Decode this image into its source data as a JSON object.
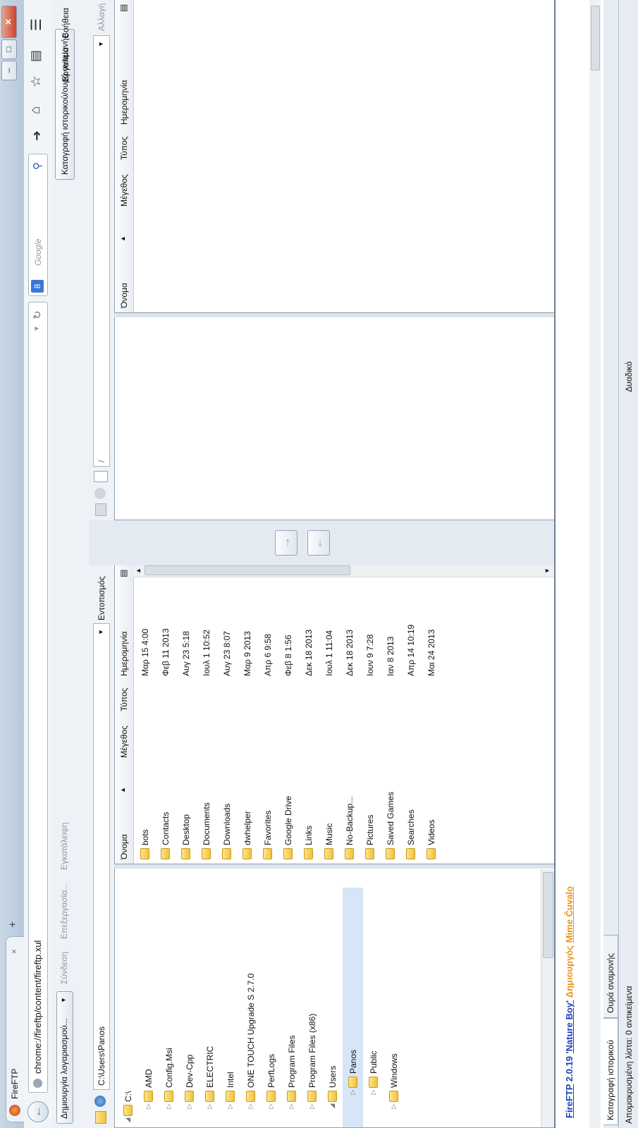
{
  "window": {
    "tab_title": "FireFTP",
    "tab_close": "×",
    "new_tab": "+",
    "caption": {
      "minimize": "–",
      "restore": "□",
      "close": "✕"
    }
  },
  "navbar": {
    "url": "chrome://fireftp/content/fireftp.xul",
    "search_placeholder": "Google",
    "search_engine_letter": "8"
  },
  "toolbar": {
    "account_select": "Δημιουργία λογαριασμού...",
    "connect": "Σύνδεση",
    "edit": "Επεξεργασία...",
    "abort": "Εγκατάλειψη",
    "log_queue_toggle": "Καταγραφή ιστορικού/ουρά αναμονής",
    "tools": "Εργαλεία",
    "help": "Βοήθεια"
  },
  "local": {
    "path": "C:\\Users\\Panos",
    "browse": "Εντοπισμός",
    "tree": [
      {
        "label": "C:\\",
        "level": 0,
        "expanded": true
      },
      {
        "label": "AMD",
        "level": 1
      },
      {
        "label": "Config.Msi",
        "level": 1
      },
      {
        "label": "Dev-Cpp",
        "level": 1
      },
      {
        "label": "ELECTRIC",
        "level": 1
      },
      {
        "label": "Intel",
        "level": 1
      },
      {
        "label": "ONE TOUCH Upgrade S 2.7.0",
        "level": 1
      },
      {
        "label": "PerfLogs",
        "level": 1
      },
      {
        "label": "Program Files",
        "level": 1
      },
      {
        "label": "Program Files (x86)",
        "level": 1
      },
      {
        "label": "Users",
        "level": 1,
        "expanded": true
      },
      {
        "label": "Panos",
        "level": 2,
        "selected": true
      },
      {
        "label": "Public",
        "level": 2
      },
      {
        "label": "Windows",
        "level": 1
      }
    ],
    "columns": {
      "name": "Όνομα",
      "size": "Μέγεθος",
      "type": "Τύπος",
      "date": "Ημερομηνία"
    },
    "files": [
      {
        "name": "bots",
        "date": "Μαρ 15 4:00"
      },
      {
        "name": "Contacts",
        "date": "Φεβ 11 2013"
      },
      {
        "name": "Desktop",
        "date": "Αυγ 23 5:18"
      },
      {
        "name": "Documents",
        "date": "Ιουλ 1 10:52"
      },
      {
        "name": "Downloads",
        "date": "Αυγ 23 8:07"
      },
      {
        "name": "dwhelper",
        "date": "Μαρ 9 2013"
      },
      {
        "name": "Favorites",
        "date": "Απρ 6 9:58"
      },
      {
        "name": "Google Drive",
        "date": "Φεβ 8 1:56"
      },
      {
        "name": "Links",
        "date": "Δεκ 18 2013"
      },
      {
        "name": "Music",
        "date": "Ιουλ 1 11:04"
      },
      {
        "name": "No-Backup...",
        "date": "Δεκ 18 2013"
      },
      {
        "name": "Pictures",
        "date": "Ιουν 9 7:28"
      },
      {
        "name": "Saved Games",
        "date": "Ιαν 8 2013"
      },
      {
        "name": "Searches",
        "date": "Απρ 14 10:19"
      },
      {
        "name": "Videos",
        "date": "Μαι 24 2013"
      }
    ]
  },
  "remote": {
    "path": "/",
    "change": "Αλλαγή",
    "columns": {
      "name": "Όνομα",
      "size": "Μέγεθος",
      "type": "Τύπος",
      "date": "Ημερομηνία"
    }
  },
  "log": {
    "product": "FireFTP",
    "version": "2.0.19",
    "codename": "'Nature Boy'",
    "creator_prefix": "Δημιουργός",
    "creator": "Mime Čuvalo"
  },
  "bottom_tabs": {
    "log": "Καταγραφή ιστορικού",
    "queue": "Ουρά αναμονής"
  },
  "status": {
    "remote_list": "Απομακρυσμένη λίστα: 0 αντικείμενα",
    "mode": "Δυαδικό"
  },
  "colors": {
    "link_blue": "#1a3fbf",
    "creator_orange": "#e8941a",
    "selection": "#d7e6f7"
  }
}
